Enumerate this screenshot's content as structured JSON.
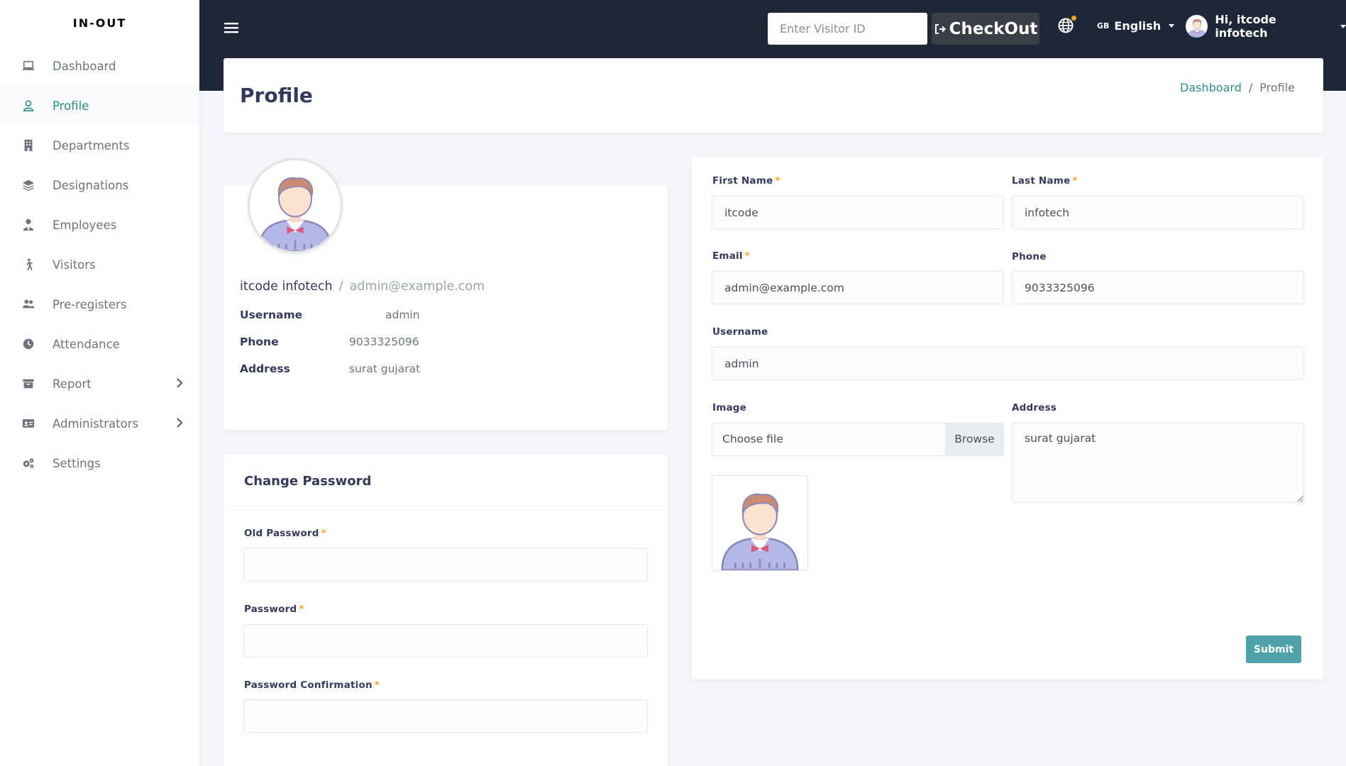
{
  "brand": "IN-OUT",
  "sidebar": {
    "items": [
      {
        "label": "Dashboard",
        "icon": "laptop-icon"
      },
      {
        "label": "Profile",
        "icon": "user-icon"
      },
      {
        "label": "Departments",
        "icon": "building-icon"
      },
      {
        "label": "Designations",
        "icon": "layers-icon"
      },
      {
        "label": "Employees",
        "icon": "user-tie-icon"
      },
      {
        "label": "Visitors",
        "icon": "walking-icon"
      },
      {
        "label": "Pre-registers",
        "icon": "users-icon"
      },
      {
        "label": "Attendance",
        "icon": "clock-icon"
      },
      {
        "label": "Report",
        "icon": "archive-icon"
      },
      {
        "label": "Administrators",
        "icon": "id-card-icon"
      },
      {
        "label": "Settings",
        "icon": "cogs-icon"
      }
    ]
  },
  "navbar": {
    "visitor_placeholder": "Enter Visitor ID",
    "checkout_label": "CheckOut",
    "language_flag": "GB",
    "language": "English",
    "user_greeting": "Hi, itcode infotech"
  },
  "header": {
    "title": "Profile",
    "breadcrumb": {
      "home": "Dashboard",
      "separator": "/",
      "current": "Profile"
    }
  },
  "profile": {
    "name": "itcode infotech",
    "separator": "/",
    "email": "admin@example.com",
    "username_label": "Username",
    "username": "admin",
    "phone_label": "Phone",
    "phone": "9033325096",
    "address_label": "Address",
    "address": "surat gujarat"
  },
  "change_password": {
    "title": "Change Password",
    "old_label": "Old Password",
    "new_label": "Password",
    "confirm_label": "Password Confirmation",
    "required_mark": "*"
  },
  "form": {
    "first_name_label": "First Name",
    "first_name": "itcode",
    "last_name_label": "Last Name",
    "last_name": "infotech",
    "email_label": "Email",
    "email": "admin@example.com",
    "phone_label": "Phone",
    "phone": "9033325096",
    "username_label": "Username",
    "username": "admin",
    "image_label": "Image",
    "file_text": "Choose file",
    "browse": "Browse",
    "address_label": "Address",
    "address": "surat gujarat",
    "submit": "Submit",
    "required_mark": "*"
  },
  "colors": {
    "navbar": "#1d2738",
    "accent": "#2b8f8a",
    "submit": "#4ea3a9",
    "required": "#f7a520"
  }
}
